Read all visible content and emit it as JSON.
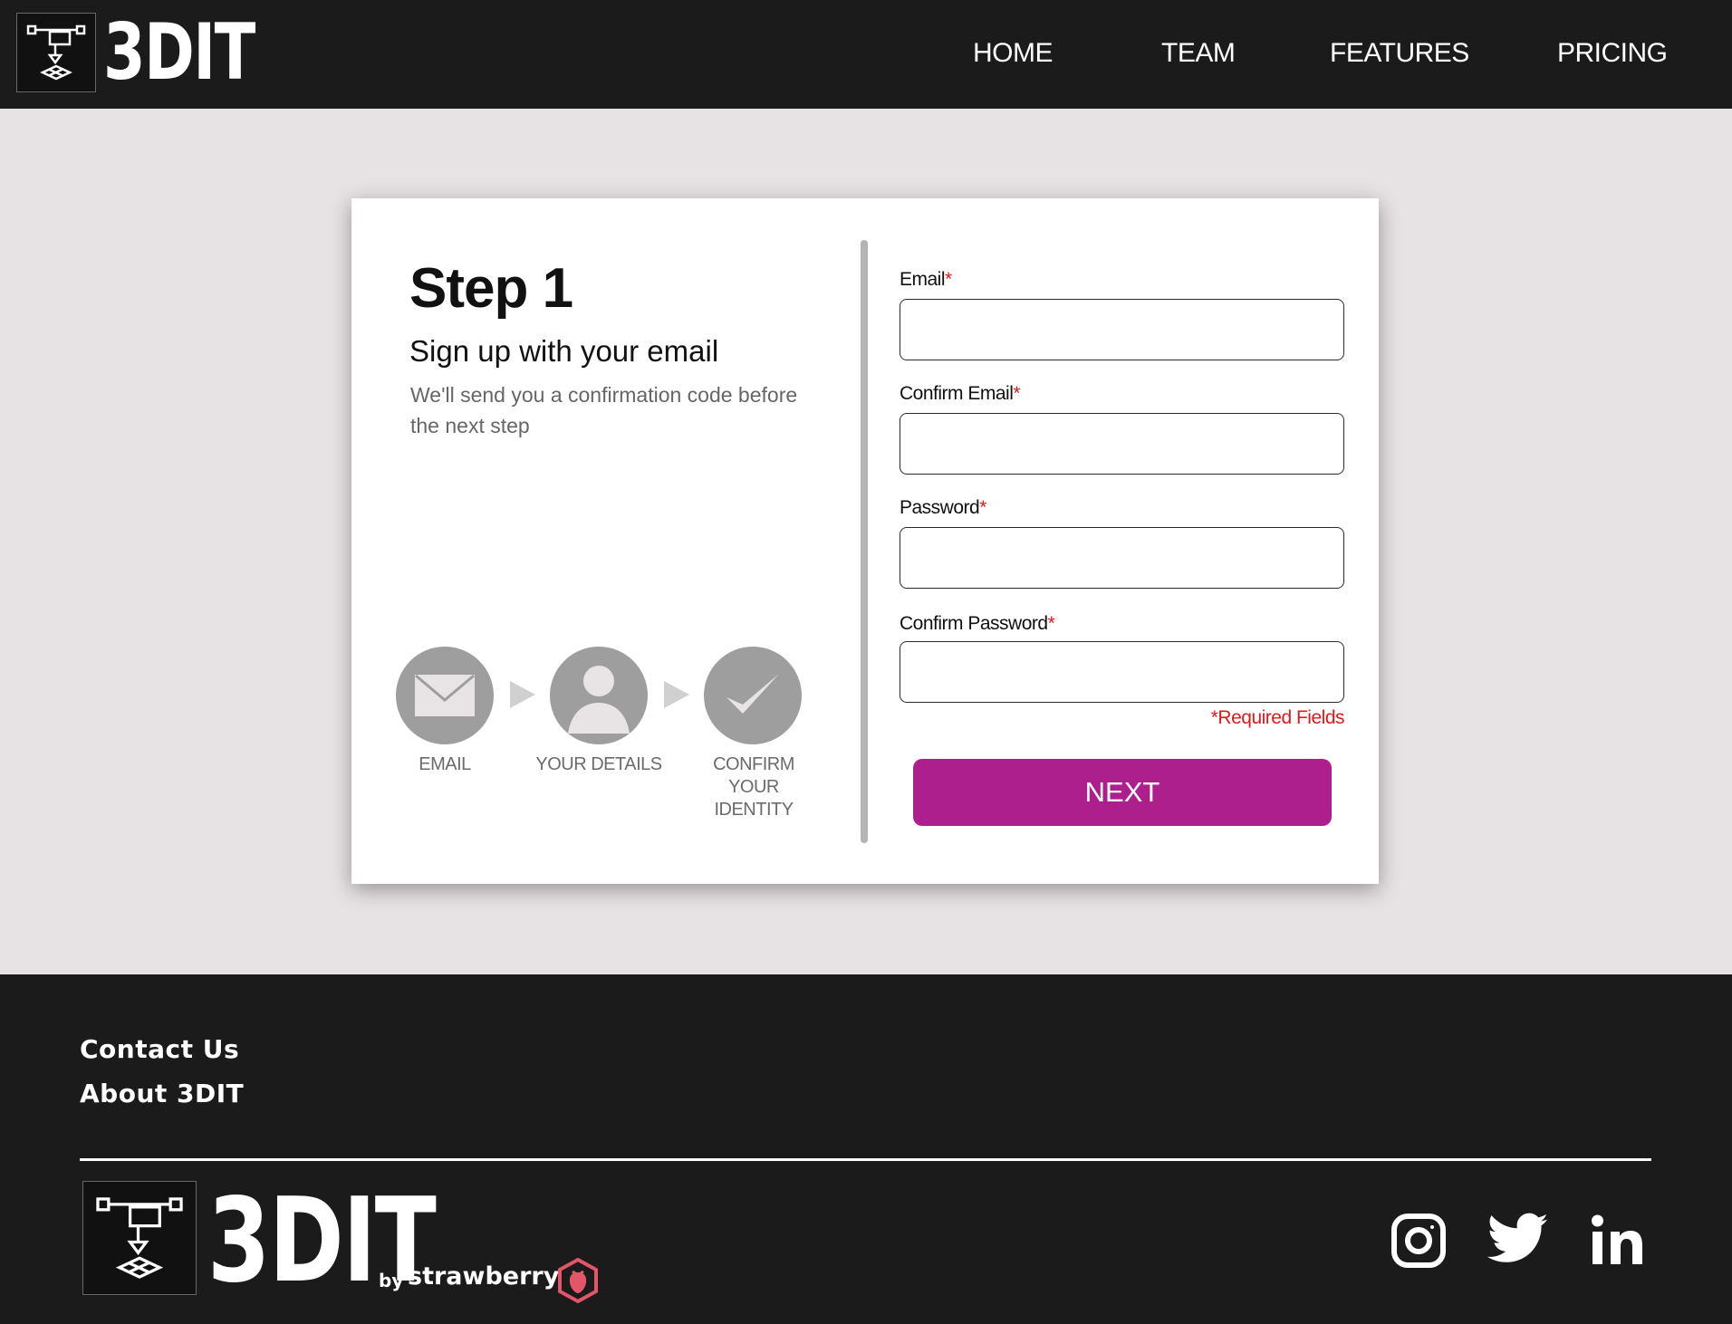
{
  "header": {
    "logo_text": "3DIT",
    "nav": [
      {
        "label": "HOME"
      },
      {
        "label": "TEAM"
      },
      {
        "label": "FEATURES"
      },
      {
        "label": "PRICING"
      }
    ]
  },
  "card": {
    "step_title": "Step 1",
    "step_subtitle": "Sign up with your email",
    "step_description": "We'll send you a confirmation code before the next step",
    "progress": [
      {
        "label": "EMAIL",
        "icon": "envelope-icon"
      },
      {
        "label": "YOUR DETAILS",
        "icon": "user-icon"
      },
      {
        "label": "CONFIRM YOUR IDENTITY",
        "icon": "checkmark-icon"
      }
    ],
    "fields": [
      {
        "label": "Email",
        "required_mark": "*",
        "value": ""
      },
      {
        "label": "Confirm Email",
        "required_mark": "*",
        "value": ""
      },
      {
        "label": "Password",
        "required_mark": "*",
        "value": ""
      },
      {
        "label": "Confirm Password",
        "required_mark": "*",
        "value": ""
      }
    ],
    "required_note": "*Required Fields",
    "next_label": "NEXT"
  },
  "footer": {
    "links": [
      {
        "label": "Contact Us"
      },
      {
        "label": "About 3DIT"
      }
    ],
    "logo_text": "3DIT",
    "by_text": "by",
    "brand_text": "strawberry",
    "social": [
      {
        "icon": "instagram-icon"
      },
      {
        "icon": "twitter-icon"
      },
      {
        "icon": "linkedin-icon"
      }
    ]
  },
  "colors": {
    "header_bg": "#1b1b1b",
    "page_bg": "#e7e2e4",
    "accent": "#ad1f8c",
    "required": "#e01a1a",
    "brand_icon": "#e3566a"
  }
}
